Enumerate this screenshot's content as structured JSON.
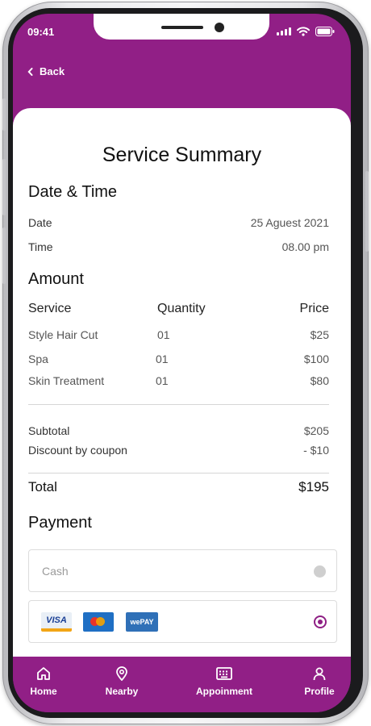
{
  "status": {
    "time": "09:41"
  },
  "header": {
    "back_label": "Back"
  },
  "summary": {
    "title": "Service Summary",
    "date_time": {
      "heading": "Date & Time",
      "date_label": "Date",
      "date_value": "25 Aguest 2021",
      "time_label": "Time",
      "time_value": "08.00 pm"
    },
    "amount": {
      "heading": "Amount",
      "columns": [
        "Service",
        "Quantity",
        "Price"
      ],
      "rows": [
        {
          "service": "Style Hair Cut",
          "qty": "01",
          "price": "$25"
        },
        {
          "service": "Spa",
          "qty": "01",
          "price": "$100"
        },
        {
          "service": "Skin Treatment",
          "qty": "01",
          "price": "$80"
        }
      ],
      "subtotal_label": "Subtotal",
      "subtotal_value": "$205",
      "discount_label": "Discount by coupon",
      "discount_value": "- $10",
      "total_label": "Total",
      "total_value": "$195"
    },
    "payment": {
      "heading": "Payment",
      "cash_label": "Cash",
      "cards": [
        "VISA",
        "mastercard",
        "wePAY"
      ],
      "selected": "cards"
    }
  },
  "tabbar": [
    {
      "label": "Home",
      "icon": "home-icon"
    },
    {
      "label": "Nearby",
      "icon": "location-pin-icon"
    },
    {
      "label": "Appoinment",
      "icon": "keyboard-icon"
    },
    {
      "label": "Profile",
      "icon": "user-icon"
    }
  ],
  "colors": {
    "accent": "#911f86",
    "divider": "#d6d6d6"
  }
}
